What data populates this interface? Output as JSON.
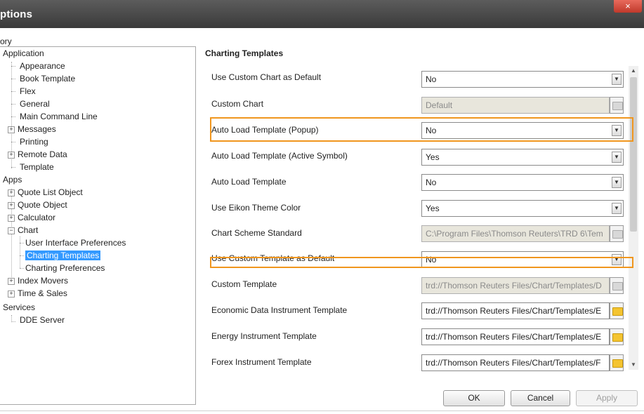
{
  "window": {
    "title": "ptions",
    "close_label": "×"
  },
  "category_label": "ory",
  "tree": [
    {
      "label": "Application",
      "name": "tree-item-application"
    },
    {
      "label": "Appearance",
      "name": "tree-item-appearance"
    },
    {
      "label": "Book Template",
      "name": "tree-item-book-template"
    },
    {
      "label": "Flex",
      "name": "tree-item-flex"
    },
    {
      "label": "General",
      "name": "tree-item-general"
    },
    {
      "label": "Main Command Line",
      "name": "tree-item-main-command-line"
    },
    {
      "label": "Messages",
      "name": "tree-item-messages"
    },
    {
      "label": "Printing",
      "name": "tree-item-printing"
    },
    {
      "label": "Remote Data",
      "name": "tree-item-remote-data"
    },
    {
      "label": "Template",
      "name": "tree-item-template"
    },
    {
      "label": "Apps",
      "name": "tree-item-apps"
    },
    {
      "label": "Quote List Object",
      "name": "tree-item-quote-list-object"
    },
    {
      "label": "Quote Object",
      "name": "tree-item-quote-object"
    },
    {
      "label": "Calculator",
      "name": "tree-item-calculator"
    },
    {
      "label": "Chart",
      "name": "tree-item-chart"
    },
    {
      "label": "User Interface Preferences",
      "name": "tree-item-user-interface-preferences"
    },
    {
      "label": "Charting Templates",
      "name": "tree-item-charting-templates"
    },
    {
      "label": "Charting Preferences",
      "name": "tree-item-charting-preferences"
    },
    {
      "label": "Index Movers",
      "name": "tree-item-index-movers"
    },
    {
      "label": "Time & Sales",
      "name": "tree-item-time-sales"
    },
    {
      "label": "Services",
      "name": "tree-item-services"
    },
    {
      "label": "DDE Server",
      "name": "tree-item-dde-server"
    }
  ],
  "tree_expanders": {
    "plus": "+",
    "minus": "−"
  },
  "section_title": "Charting Templates",
  "settings": [
    {
      "label": "Use Custom Chart as Default",
      "value": "No"
    },
    {
      "label": "Custom Chart",
      "value": "Default"
    },
    {
      "label": "Auto Load Template (Popup)",
      "value": "No"
    },
    {
      "label": "Auto Load Template (Active Symbol)",
      "value": "Yes"
    },
    {
      "label": "Auto Load Template",
      "value": "No"
    },
    {
      "label": "Use Eikon Theme Color",
      "value": "Yes"
    },
    {
      "label": "Chart Scheme Standard",
      "value": "C:\\Program Files\\Thomson Reuters\\TRD 6\\Tem"
    },
    {
      "label": "Use Custom Template as Default",
      "value": "No"
    },
    {
      "label": "Custom Template",
      "value": "trd://Thomson Reuters Files/Chart/Templates/D"
    },
    {
      "label": "Economic Data Instrument Template",
      "value": "trd://Thomson Reuters Files/Chart/Templates/E"
    },
    {
      "label": "Energy Instrument Template",
      "value": "trd://Thomson Reuters Files/Chart/Templates/E"
    },
    {
      "label": "Forex Instrument Template",
      "value": "trd://Thomson Reuters Files/Chart/Templates/F"
    }
  ],
  "glyphs": {
    "dropdown": "▼",
    "scroll_up": "▲",
    "scroll_down": "▼"
  },
  "buttons": {
    "ok": "OK",
    "cancel": "Cancel",
    "apply": "Apply"
  },
  "colors": {
    "highlight": "#f0961e",
    "selection": "#3399ff",
    "close": "#c0392b"
  }
}
